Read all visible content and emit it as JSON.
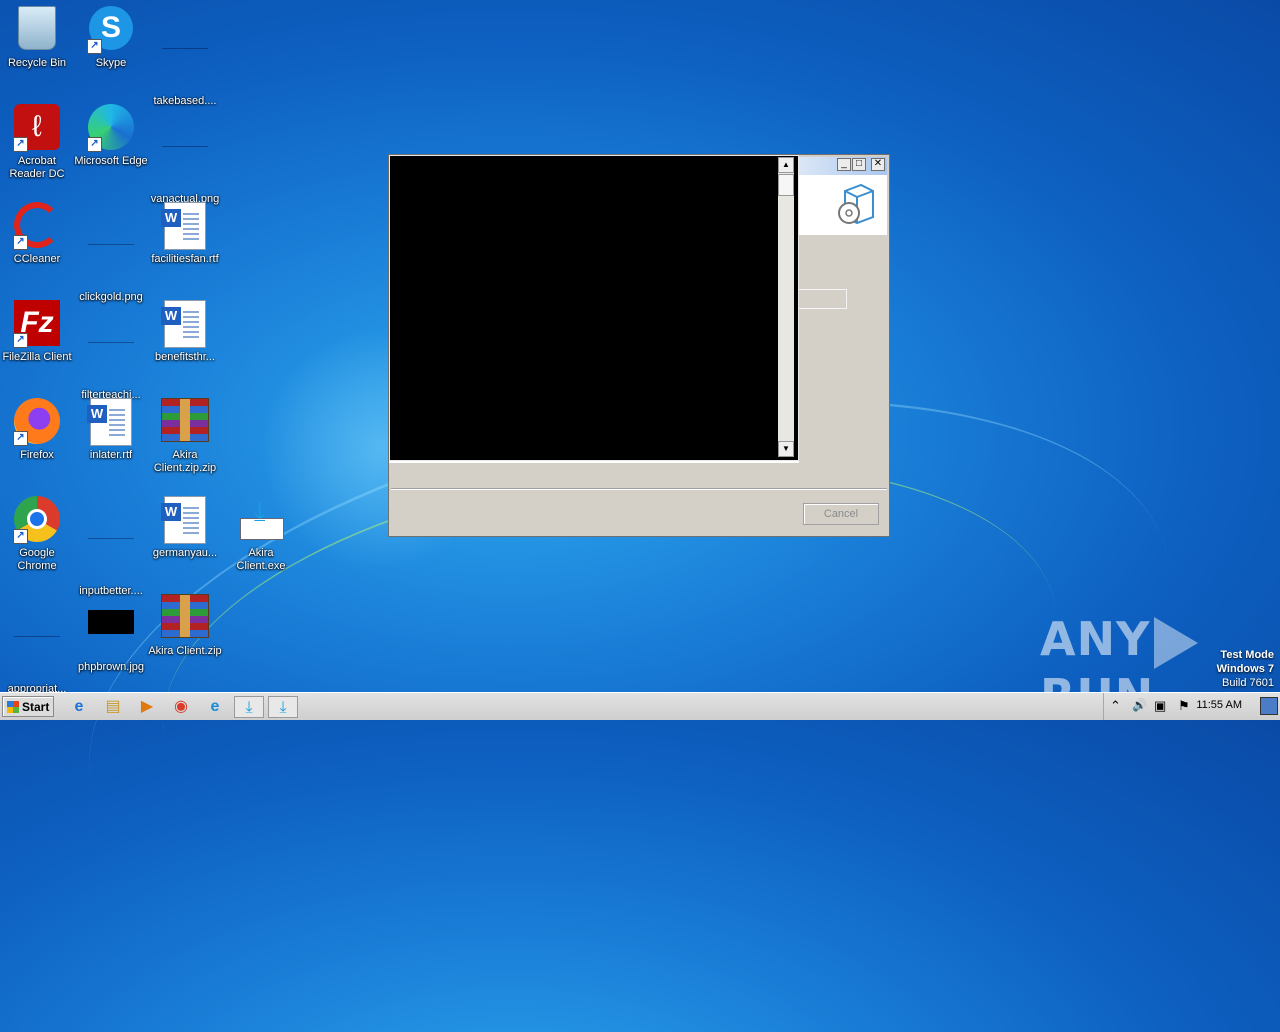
{
  "desktop": {
    "icons": [
      {
        "label": "Recycle Bin"
      },
      {
        "label": "Skype"
      },
      {
        "label": "takebased...."
      },
      {
        "label": "Acrobat Reader DC"
      },
      {
        "label": "Microsoft Edge"
      },
      {
        "label": "vanactual.png"
      },
      {
        "label": "CCleaner"
      },
      {
        "label": "clickgold.png"
      },
      {
        "label": "facilitiesfan.rtf"
      },
      {
        "label": "FileZilla Client"
      },
      {
        "label": "filterteachi..."
      },
      {
        "label": "benefitsthr..."
      },
      {
        "label": "Firefox"
      },
      {
        "label": "inlater.rtf"
      },
      {
        "label": "Akira Client.zip.zip"
      },
      {
        "label": "Google Chrome"
      },
      {
        "label": "inputbetter...."
      },
      {
        "label": "germanyau..."
      },
      {
        "label": "Akira Client.exe"
      },
      {
        "label": "appropriat..."
      },
      {
        "label": "phpbrown.jpg"
      },
      {
        "label": "Akira Client.zip"
      }
    ]
  },
  "installer_window": {
    "minimize_glyph": "_",
    "maximize_glyph": "□",
    "close_glyph": "✕",
    "cancel_label": "Cancel",
    "scroll_up_glyph": "▲",
    "scroll_down_glyph": "▼"
  },
  "watermark": {
    "left": "ANY",
    "right": "RUN"
  },
  "test_mode": {
    "line1": "Test Mode",
    "line2": "Windows 7",
    "line3": "Build 7601"
  },
  "taskbar": {
    "start_label": "Start",
    "clock": "11:55 AM",
    "items": [
      {
        "icon": "ie-icon",
        "glyph": "e"
      },
      {
        "icon": "explorer-icon",
        "glyph": "▤"
      },
      {
        "icon": "media-player-icon",
        "glyph": "▶"
      },
      {
        "icon": "chrome-icon",
        "glyph": "◉"
      },
      {
        "icon": "edge-icon",
        "glyph": "e"
      },
      {
        "icon": "installer-icon",
        "glyph": "⤓"
      },
      {
        "icon": "installer-icon",
        "glyph": "⤓"
      }
    ],
    "tray": {
      "chevron": "⌃",
      "volume": "🔊",
      "network": "▣",
      "flag": "⚑"
    }
  },
  "colors": {
    "desktop_blue": "#1a7fd8",
    "window_gray": "#d4d0c8",
    "console_black": "#000000"
  }
}
